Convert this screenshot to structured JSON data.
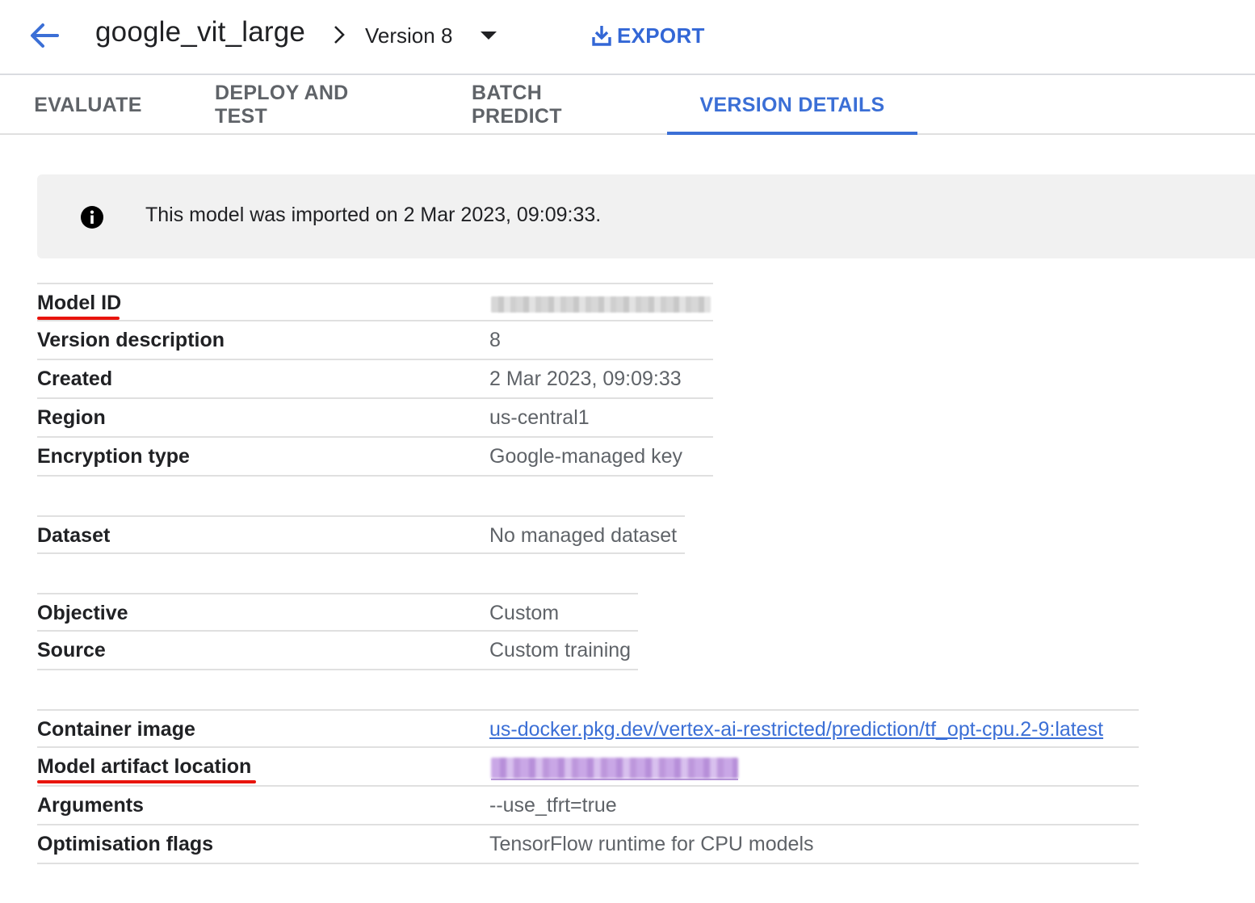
{
  "header": {
    "model_name": "google_vit_large",
    "version_label": "Version 8",
    "export_label": "EXPORT"
  },
  "tabs": [
    {
      "label": "EVALUATE",
      "active": false
    },
    {
      "label": "DEPLOY AND TEST",
      "active": false
    },
    {
      "label": "BATCH PREDICT",
      "active": false
    },
    {
      "label": "VERSION DETAILS",
      "active": true
    }
  ],
  "banner": {
    "text": "This model was imported on 2 Mar 2023, 09:09:33."
  },
  "details": {
    "basic": [
      {
        "label": "Model ID",
        "value": ""
      },
      {
        "label": "Version description",
        "value": "8"
      },
      {
        "label": "Created",
        "value": "2 Mar 2023, 09:09:33"
      },
      {
        "label": "Region",
        "value": "us-central1"
      },
      {
        "label": "Encryption type",
        "value": "Google-managed key"
      }
    ],
    "dataset": [
      {
        "label": "Dataset",
        "value": "No managed dataset"
      }
    ],
    "training": [
      {
        "label": "Objective",
        "value": "Custom"
      },
      {
        "label": "Source",
        "value": "Custom training"
      }
    ],
    "container": [
      {
        "label": "Container image",
        "value": "us-docker.pkg.dev/vertex-ai-restricted/prediction/tf_opt-cpu.2-9:latest"
      },
      {
        "label": "Model artifact location",
        "value": ""
      },
      {
        "label": "Arguments",
        "value": "--use_tfrt=true"
      },
      {
        "label": "Optimisation flags",
        "value": "TensorFlow runtime for CPU models"
      }
    ]
  },
  "colors": {
    "accent": "#3b6fd6",
    "annotation_underline": "#e8140c",
    "banner_bg": "#f1f1f1"
  },
  "icons": {
    "back": "arrow-back-icon",
    "breadcrumb": "chevron-right-icon",
    "dropdown": "dropdown-arrow-icon",
    "export": "download-icon",
    "info": "info-icon"
  }
}
